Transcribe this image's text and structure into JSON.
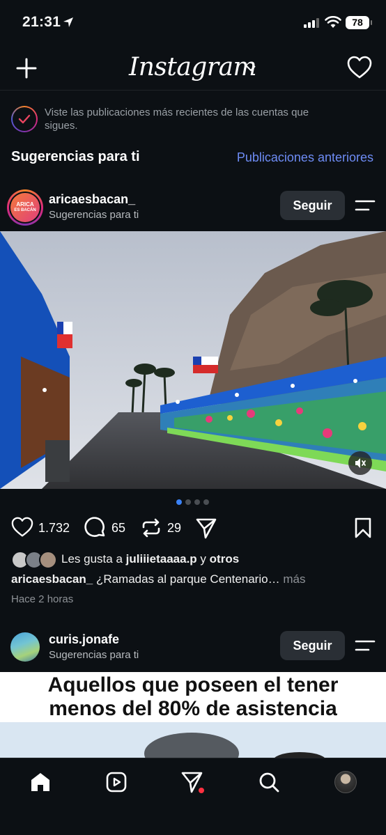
{
  "status_bar": {
    "time": "21:31",
    "battery": "78"
  },
  "header": {
    "logo": "Instagram",
    "icons": [
      "plus-icon",
      "chevron-down-icon",
      "heart-icon"
    ]
  },
  "banner": {
    "text": "Viste las publicaciones más recientes de las cuentas que sigues."
  },
  "section": {
    "title": "Sugerencias para ti",
    "link": "Publicaciones anteriores"
  },
  "post1": {
    "username": "aricaesbacan_",
    "subtitle": "Sugerencias para ti",
    "avatar_text_1": "ARICA",
    "avatar_text_2": "ES BACÁN",
    "follow_label": "Seguir",
    "likes_count": "1.732",
    "comments_count": "65",
    "reposts_count": "29",
    "likes_prefix": "Les gusta a",
    "liked_by": "juliiietaaaa.p",
    "likes_and": "y",
    "likes_others": "otros",
    "caption_user": "aricaesbacan_",
    "caption_text": "¿Ramadas al parque Centenario…",
    "caption_more": "más",
    "time_ago": "Hace 2 horas",
    "carousel": {
      "count": 4,
      "active": 1
    }
  },
  "post2": {
    "username": "curis.jonafe",
    "subtitle": "Sugerencias para ti",
    "follow_label": "Seguir",
    "meme_line1": "Aquellos que poseen el tener",
    "meme_line2": "menos del 80% de asistencia"
  },
  "tab_bar": {
    "tabs": [
      "home-icon",
      "reels-icon",
      "direct-icon",
      "search-icon",
      "profile-avatar"
    ],
    "active": "home-icon",
    "accent_dot": "#ff3040"
  },
  "colors": {
    "background": "#0c1014",
    "link": "#6e8cf5",
    "button": "#2a2f35"
  }
}
